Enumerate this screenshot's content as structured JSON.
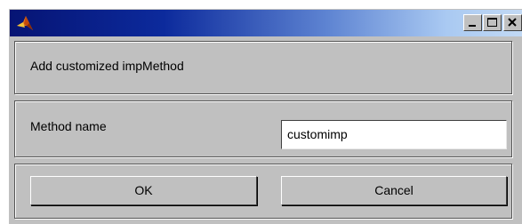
{
  "window": {
    "title": "",
    "icon": "matlab-logo-icon",
    "controls": [
      "minimize-icon",
      "maximize-icon",
      "close-icon"
    ]
  },
  "dialog": {
    "header": "Add customized impMethod",
    "method_name_label": "Method name",
    "method_name_value": "customimp",
    "ok_label": "OK",
    "cancel_label": "Cancel"
  },
  "colors": {
    "title_bar_start": "#061474",
    "title_bar_end": "#c2d9f4",
    "dialog_background": "#c0c0c0"
  }
}
